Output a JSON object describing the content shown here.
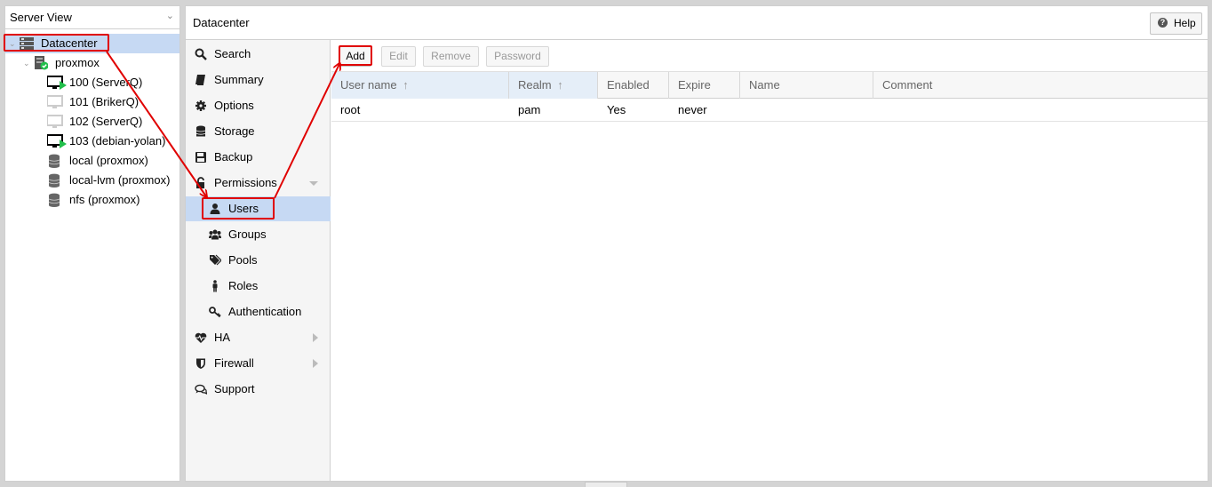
{
  "left": {
    "view_select": "Server View",
    "tree": [
      {
        "label": "Datacenter",
        "icon": "datacenter-icon"
      },
      {
        "label": "proxmox",
        "icon": "node-icon"
      },
      {
        "label": "100 (ServerQ)",
        "icon": "vm-running-icon"
      },
      {
        "label": "101 (BrikerQ)",
        "icon": "vm-stopped-icon"
      },
      {
        "label": "102 (ServerQ)",
        "icon": "vm-stopped-icon"
      },
      {
        "label": "103 (debian-yolan)",
        "icon": "vm-running-icon"
      },
      {
        "label": "local (proxmox)",
        "icon": "storage-icon"
      },
      {
        "label": "local-lvm (proxmox)",
        "icon": "storage-icon"
      },
      {
        "label": "nfs (proxmox)",
        "icon": "storage-icon"
      }
    ]
  },
  "header": {
    "title": "Datacenter",
    "help": "Help"
  },
  "nav": [
    {
      "label": "Search",
      "icon": "search-icon"
    },
    {
      "label": "Summary",
      "icon": "book-icon"
    },
    {
      "label": "Options",
      "icon": "gear-icon"
    },
    {
      "label": "Storage",
      "icon": "database-icon"
    },
    {
      "label": "Backup",
      "icon": "floppy-icon"
    },
    {
      "label": "Permissions",
      "icon": "unlock-icon"
    },
    {
      "label": "Users",
      "icon": "user-icon"
    },
    {
      "label": "Groups",
      "icon": "users-icon"
    },
    {
      "label": "Pools",
      "icon": "tags-icon"
    },
    {
      "label": "Roles",
      "icon": "male-icon"
    },
    {
      "label": "Authentication",
      "icon": "key-icon"
    },
    {
      "label": "HA",
      "icon": "heartbeat-icon"
    },
    {
      "label": "Firewall",
      "icon": "shield-icon"
    },
    {
      "label": "Support",
      "icon": "comments-icon"
    }
  ],
  "toolbar": {
    "add": "Add",
    "edit": "Edit",
    "remove": "Remove",
    "password": "Password"
  },
  "grid": {
    "columns": [
      "User name",
      "Realm",
      "Enabled",
      "Expire",
      "Name",
      "Comment"
    ],
    "sort_glyph": "↑",
    "rows": [
      {
        "user": "root",
        "realm": "pam",
        "enabled": "Yes",
        "expire": "never",
        "name": "",
        "comment": ""
      }
    ]
  },
  "colors": {
    "selected": "#c6d9f3",
    "annotation": "#e00000",
    "running": "#21bf4b"
  }
}
